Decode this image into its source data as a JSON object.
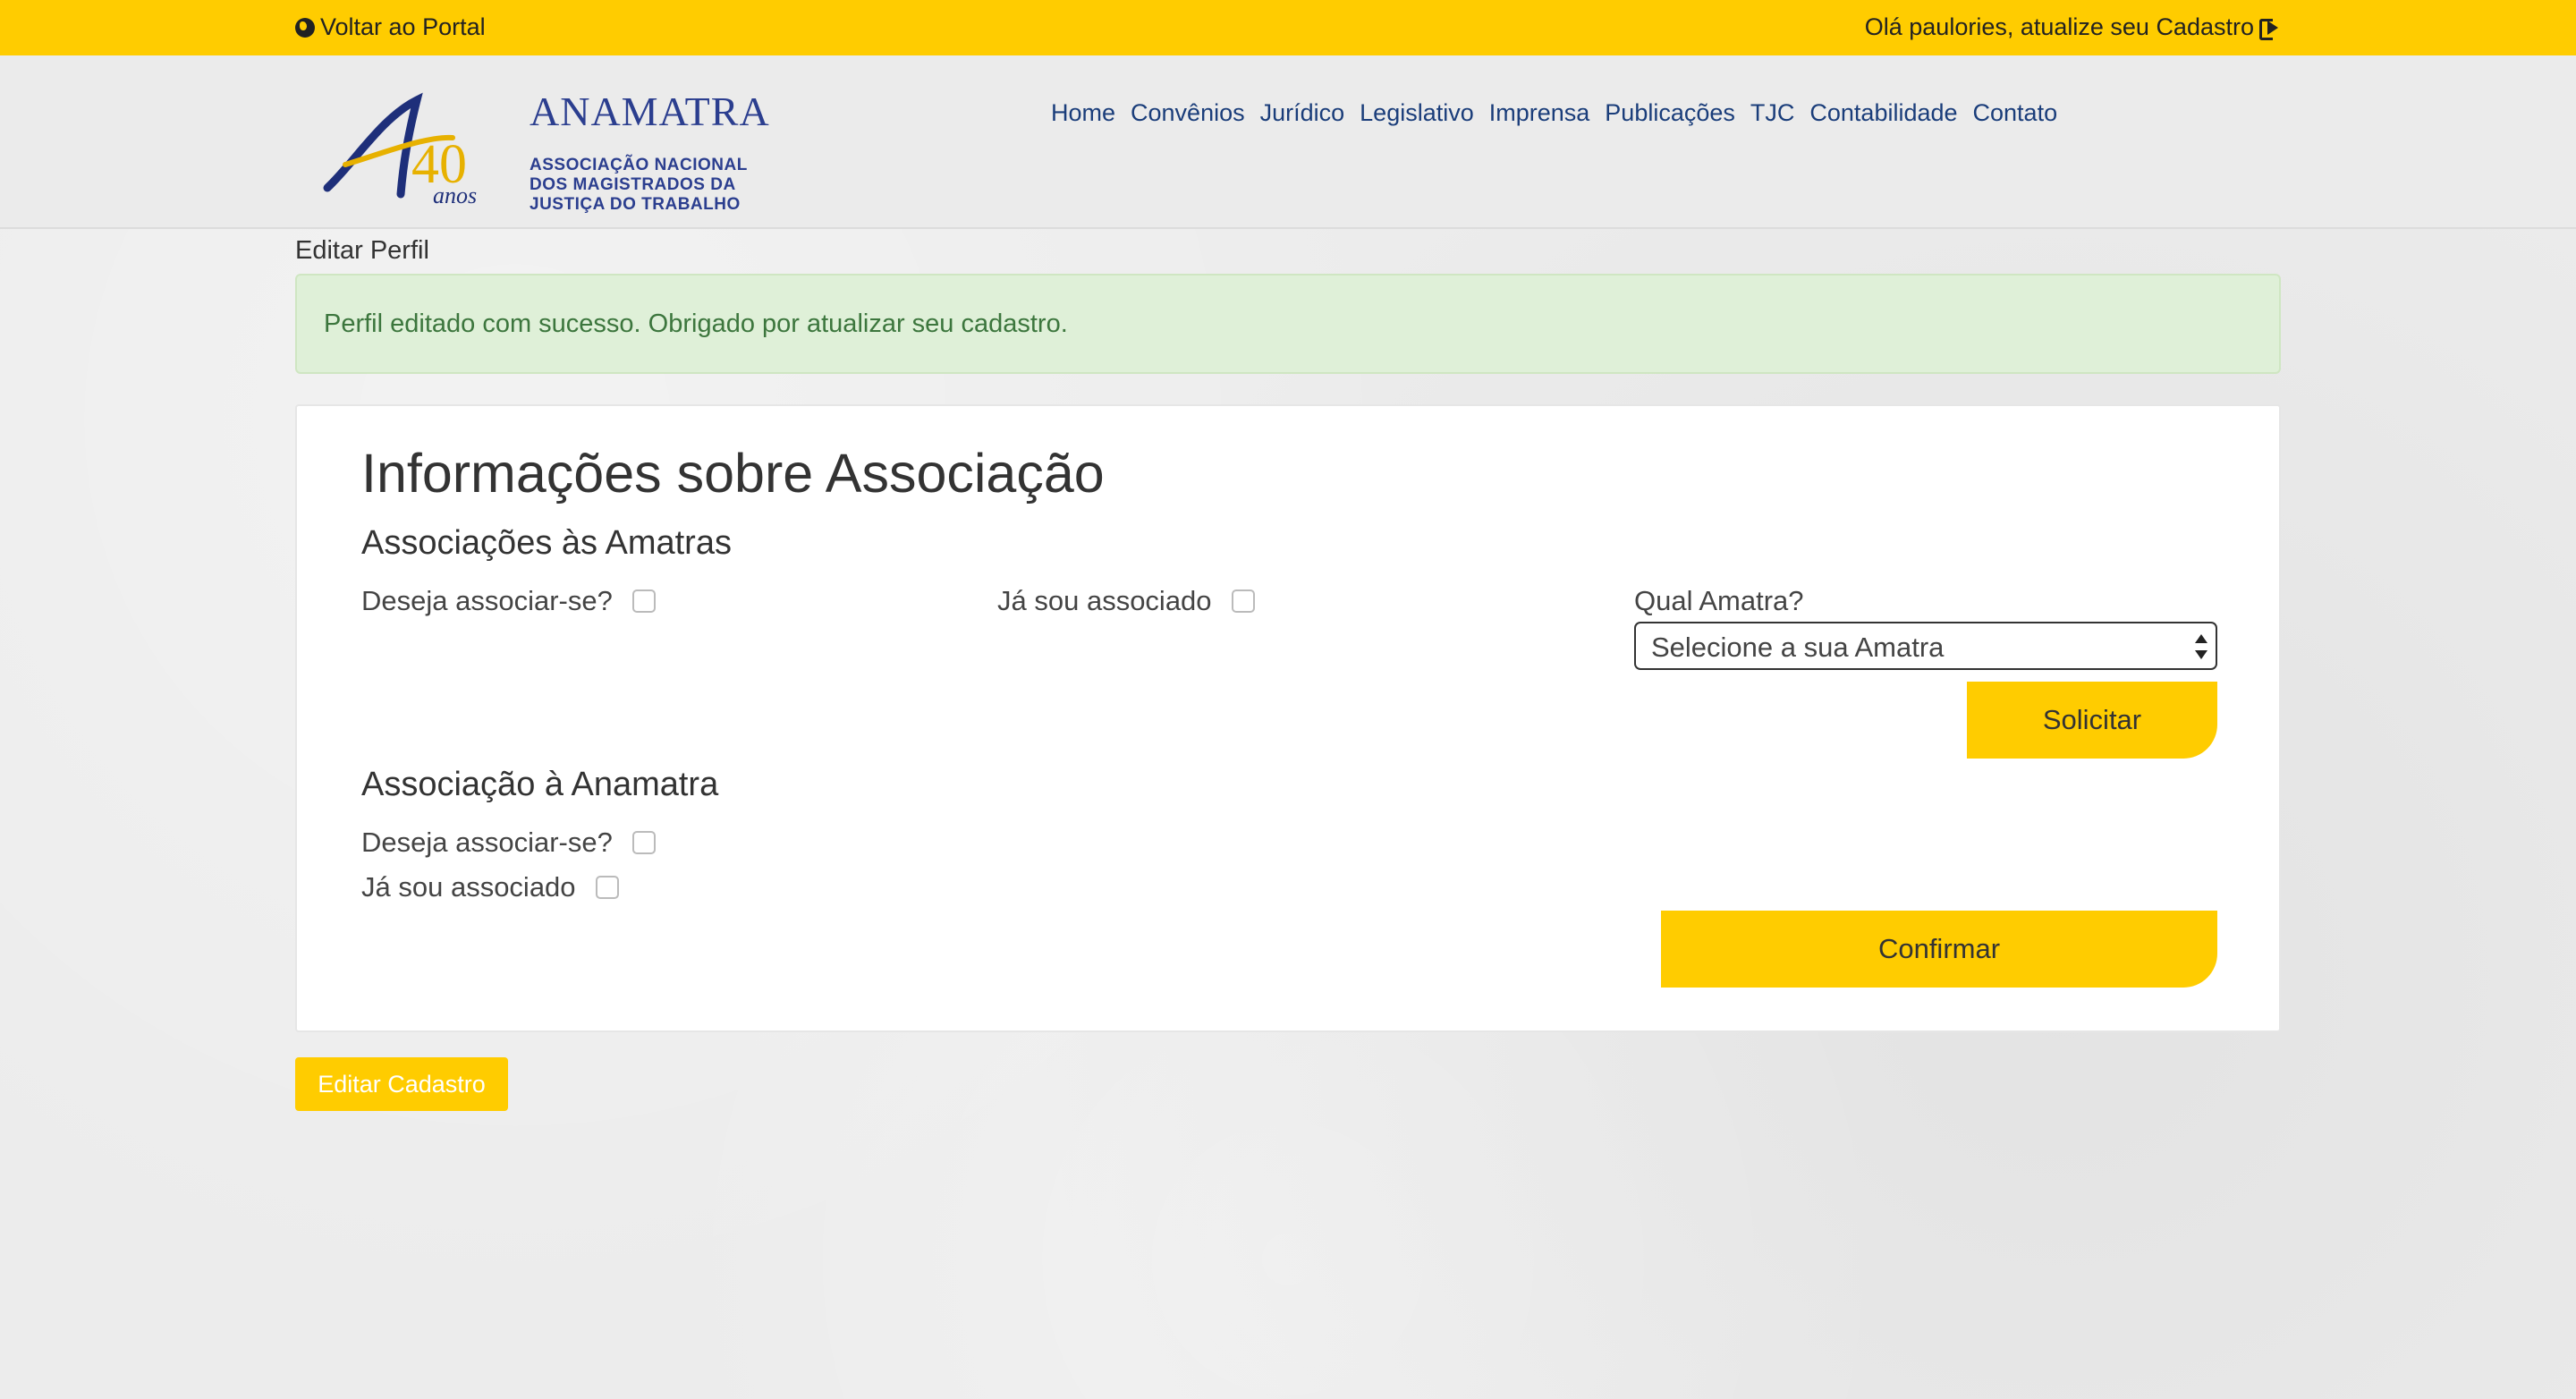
{
  "topbar": {
    "back_label": "Voltar ao Portal",
    "user_label": "Olá paulories, atualize seu Cadastro"
  },
  "logo": {
    "brand": "ANAMATRA",
    "line1": "ASSOCIAÇÃO NACIONAL",
    "line2": "DOS MAGISTRADOS DA",
    "line3": "JUSTIÇA DO TRABALHO",
    "years": "40",
    "anos": "anos"
  },
  "nav": {
    "items": [
      "Home",
      "Convênios",
      "Jurídico",
      "Legislativo",
      "Imprensa",
      "Publicações",
      "TJC",
      "Contabilidade",
      "Contato"
    ]
  },
  "breadcrumb": "Editar Perfil",
  "alert": "Perfil editado com sucesso. Obrigado por atualizar seu cadastro.",
  "card": {
    "title": "Informações sobre Associação",
    "amatras": {
      "heading": "Associações às Amatras",
      "want_label": "Deseja associar-se?",
      "already_label": "Já sou associado",
      "which_label": "Qual Amatra?",
      "select_value": "Selecione a sua Amatra",
      "submit_label": "Solicitar"
    },
    "anamatra": {
      "heading": "Associação à Anamatra",
      "want_label": "Deseja associar-se?",
      "already_label": "Já sou associado",
      "confirm_label": "Confirmar"
    }
  },
  "edit_button": "Editar Cadastro",
  "colors": {
    "accent": "#ffcc00",
    "brand_blue": "#2b3e8f",
    "success_bg": "#dff0d8",
    "success_text": "#3c763d"
  }
}
